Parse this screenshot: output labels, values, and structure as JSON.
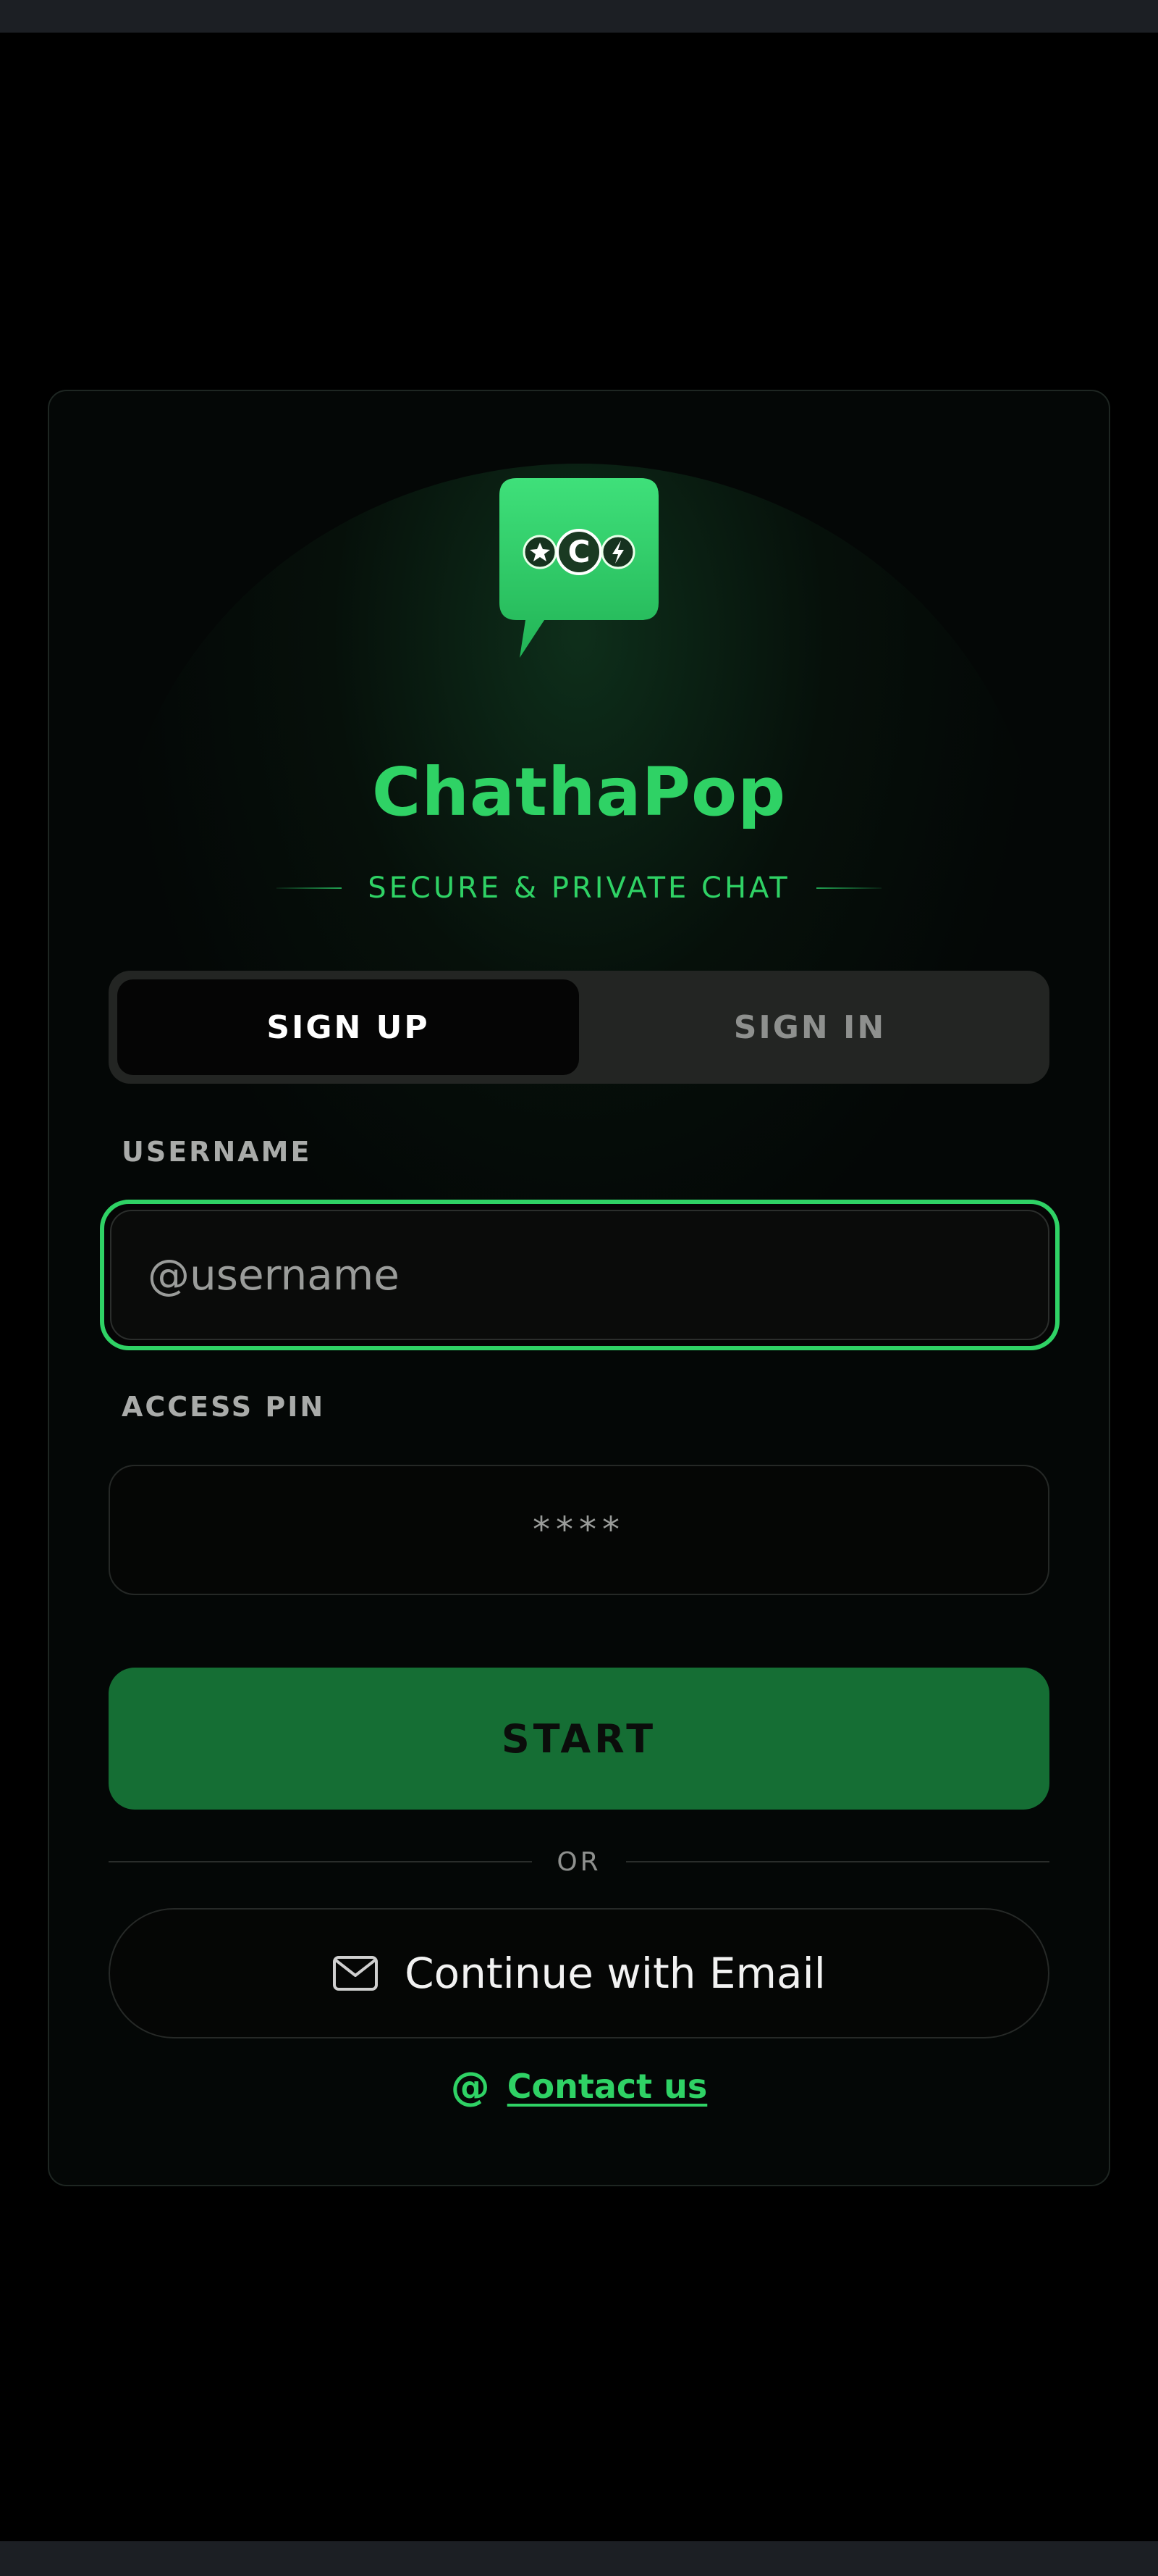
{
  "app": {
    "title": "ChathaPop",
    "tagline": "SECURE & PRIVATE CHAT",
    "accent_color": "#2fd265",
    "logo_icon": "chat-bubble-logo-icon"
  },
  "tabs": [
    {
      "label": "SIGN UP",
      "active": true
    },
    {
      "label": "SIGN IN",
      "active": false
    }
  ],
  "form": {
    "username_label": "USERNAME",
    "username_placeholder": "@username",
    "pin_label": "ACCESS PIN",
    "pin_placeholder": "****",
    "start_label": "START"
  },
  "divider": {
    "label": "OR"
  },
  "email": {
    "label": "Continue with Email",
    "icon": "mail-icon"
  },
  "contact": {
    "icon": "at-icon",
    "at_symbol": "@",
    "label": "Contact us"
  }
}
